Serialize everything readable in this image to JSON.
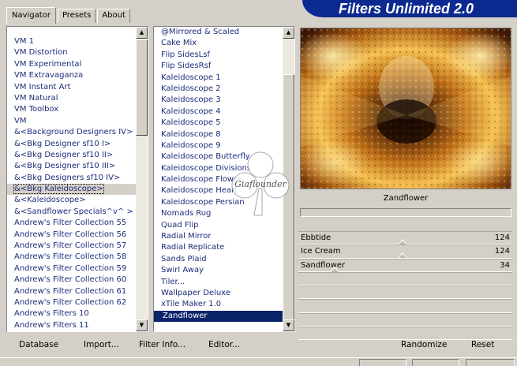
{
  "brand": {
    "title": "Filters Unlimited 2.0"
  },
  "tabs": [
    {
      "label": "Navigator",
      "active": true
    },
    {
      "label": "Presets",
      "active": false
    },
    {
      "label": "About",
      "active": false
    }
  ],
  "categories": {
    "items": [
      "VM 1",
      "VM Distortion",
      "VM Experimental",
      "VM Extravaganza",
      "VM Instant Art",
      "VM Natural",
      "VM Toolbox",
      "VM",
      "&<Background Designers IV>",
      "&<Bkg Designer sf10 I>",
      "&<Bkg Designer sf10 II>",
      "&<Bkg Designer sf10 III>",
      "&<Bkg Designers sf10 IV>",
      "&<Bkg Kaleidoscope>",
      "&<Kaleidoscope>",
      "&<Sandflower Specials^v^ >",
      "Andrew's Filter Collection 55",
      "Andrew's Filter Collection 56",
      "Andrew's Filter Collection 57",
      "Andrew's Filter Collection 58",
      "Andrew's Filter Collection 59",
      "Andrew's Filter Collection 60",
      "Andrew's Filter Collection 61",
      "Andrew's Filter Collection 62",
      "Andrew's Filters 10",
      "Andrew's Filters 11"
    ],
    "selected_index": 13
  },
  "filters": {
    "items": [
      "@Mirrored & Scaled",
      "Cake Mix",
      "Flip SidesLsf",
      "Flip SidesRsf",
      "Kaleidoscope 1",
      "Kaleidoscope 2",
      "Kaleidoscope 3",
      "Kaleidoscope 4",
      "Kaleidoscope 5",
      "Kaleidoscope 8",
      "Kaleidoscope 9",
      "Kaleidoscope Butterfly",
      "Kaleidoscope Divisions",
      "Kaleidoscope Flower",
      "Kaleidoscope Heart",
      "Kaleidoscope Persian",
      "Nomads Rug",
      "Quad Flip",
      "Radial Mirror",
      "Radial Replicate",
      "Sands Plaid",
      "Swirl Away",
      "Tiler...",
      "Wallpaper Deluxe",
      "xTile Maker 1.0",
      "Zandflower"
    ],
    "selected_index": 25
  },
  "preview": {
    "filter_name": "Zandflower"
  },
  "parameters": [
    {
      "label": "Ebbtide",
      "value": "124",
      "level": 124
    },
    {
      "label": "Ice Cream",
      "value": "124",
      "level": 124
    },
    {
      "label": "Sandflower",
      "value": "34",
      "level": 34
    }
  ],
  "parameter_max": 255,
  "buttons": {
    "database": "Database",
    "import": "Import...",
    "filter_info": "Filter Info...",
    "editor": "Editor...",
    "randomize": "Randomize",
    "reset": "Reset"
  },
  "watermark": {
    "text": "Giaflounder"
  },
  "colors": {
    "brand_blue": "#0b2990",
    "selection": "#0a246a",
    "list_text": "#1c2c7a"
  }
}
